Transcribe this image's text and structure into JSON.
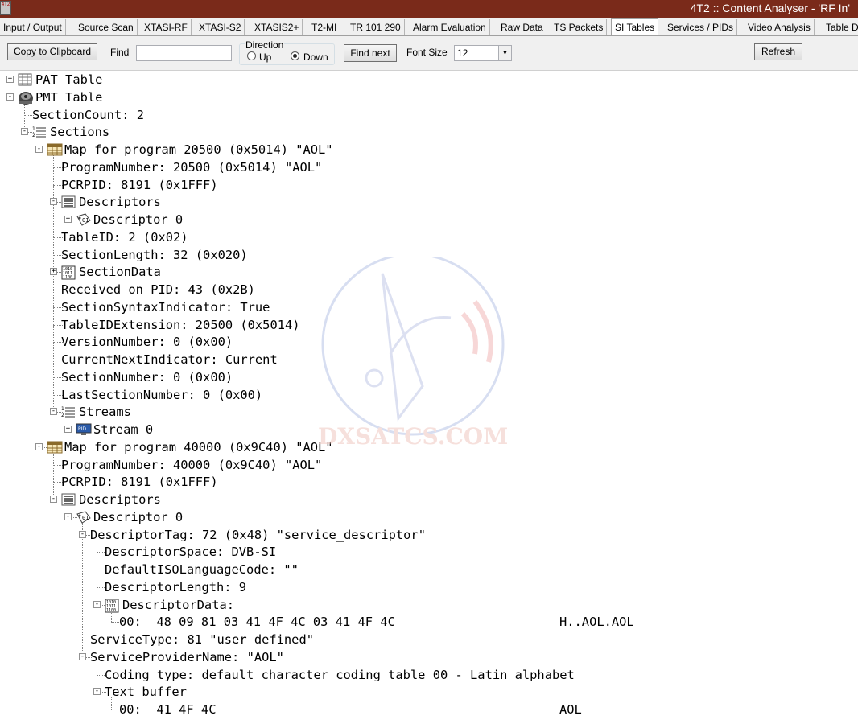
{
  "window": {
    "title": "4T2 :: Content Analyser - 'RF In'",
    "icon_label": "4T2"
  },
  "tabs": [
    {
      "label": "Input / Output"
    },
    {
      "label": "Source Scan"
    },
    {
      "label": "XTASI-RF"
    },
    {
      "label": "XTASI-S2"
    },
    {
      "label": "XTASIS2+"
    },
    {
      "label": "T2-MI"
    },
    {
      "label": "TR 101 290"
    },
    {
      "label": "Alarm Evaluation"
    },
    {
      "label": "Raw Data"
    },
    {
      "label": "TS Packets"
    },
    {
      "label": "SI Tables",
      "active": true
    },
    {
      "label": "Services / PIDs"
    },
    {
      "label": "Video Analysis"
    },
    {
      "label": "Table D"
    }
  ],
  "toolbar": {
    "copy_label": "Copy to Clipboard",
    "find_label": "Find",
    "find_value": "",
    "direction_label": "Direction",
    "up_label": "Up",
    "down_label": "Down",
    "direction_selected": "Down",
    "find_next_label": "Find next",
    "font_size_label": "Font Size",
    "font_size_value": "12",
    "refresh_label": "Refresh"
  },
  "tree": [
    {
      "text": "PAT Table",
      "expander": "+",
      "icon": "table-grid-icon"
    },
    {
      "text": "PMT Table",
      "expander": "-",
      "icon": "film-reel-icon"
    },
    {
      "text": "SectionCount: 2"
    },
    {
      "text": "Sections",
      "expander": "-",
      "icon": "numbered-list-icon"
    },
    {
      "text": "Map for program 20500 (0x5014) \"AOL\"",
      "expander": "-",
      "icon": "map-table-icon"
    },
    {
      "text": "ProgramNumber: 20500 (0x5014) \"AOL\""
    },
    {
      "text": "PCRPID: 8191 (0x1FFF)"
    },
    {
      "text": "Descriptors",
      "expander": "-",
      "icon": "lines-list-icon"
    },
    {
      "text": "Descriptor 0",
      "expander": "+",
      "icon": "descriptor-tag-icon"
    },
    {
      "text": "TableID: 2 (0x02)"
    },
    {
      "text": "SectionLength: 32 (0x020)"
    },
    {
      "text": "SectionData",
      "expander": "+",
      "icon": "binary-data-icon"
    },
    {
      "text": "Received on PID: 43 (0x2B)"
    },
    {
      "text": "SectionSyntaxIndicator: True"
    },
    {
      "text": "TableIDExtension: 20500 (0x5014)"
    },
    {
      "text": "VersionNumber: 0 (0x00)"
    },
    {
      "text": "CurrentNextIndicator: Current"
    },
    {
      "text": "SectionNumber: 0 (0x00)"
    },
    {
      "text": "LastSectionNumber: 0 (0x00)"
    },
    {
      "text": "Streams",
      "expander": "-",
      "icon": "numbered-list-icon"
    },
    {
      "text": "Stream 0",
      "expander": "+",
      "icon": "video-stream-icon"
    },
    {
      "text": "Map for program 40000 (0x9C40) \"AOL\"",
      "expander": "-",
      "icon": "map-table-icon"
    },
    {
      "text": "ProgramNumber: 40000 (0x9C40) \"AOL\""
    },
    {
      "text": "PCRPID: 8191 (0x1FFF)"
    },
    {
      "text": "Descriptors",
      "expander": "-",
      "icon": "lines-list-icon"
    },
    {
      "text": "Descriptor 0",
      "expander": "-",
      "icon": "descriptor-tag-icon"
    },
    {
      "text": "DescriptorTag: 72 (0x48) \"service_descriptor\"",
      "expander": "-"
    },
    {
      "text": "DescriptorSpace: DVB-SI"
    },
    {
      "text": "DefaultISOLanguageCode: \"\""
    },
    {
      "text": "DescriptorLength: 9"
    },
    {
      "text": "DescriptorData:",
      "expander": "-",
      "icon": "binary-data-icon"
    },
    {
      "text": "00:  48 09 81 03 41 4F 4C 03 41 4F 4C",
      "ascii": "H..AOL.AOL"
    },
    {
      "text": "ServiceType: 81 \"user defined\""
    },
    {
      "text": "ServiceProviderName: \"AOL\"",
      "expander": "-"
    },
    {
      "text": "Coding type: default character coding table 00 - Latin alphabet"
    },
    {
      "text": "Text buffer",
      "expander": "-"
    },
    {
      "text": "00:  41 4F 4C",
      "ascii": "AOL"
    }
  ],
  "watermark": {
    "text": "DXSATCS.COM"
  },
  "colors": {
    "titlebar": "#7a2a1a",
    "tab_bg": "#f0f0f0",
    "tree_lines": "#808080"
  }
}
